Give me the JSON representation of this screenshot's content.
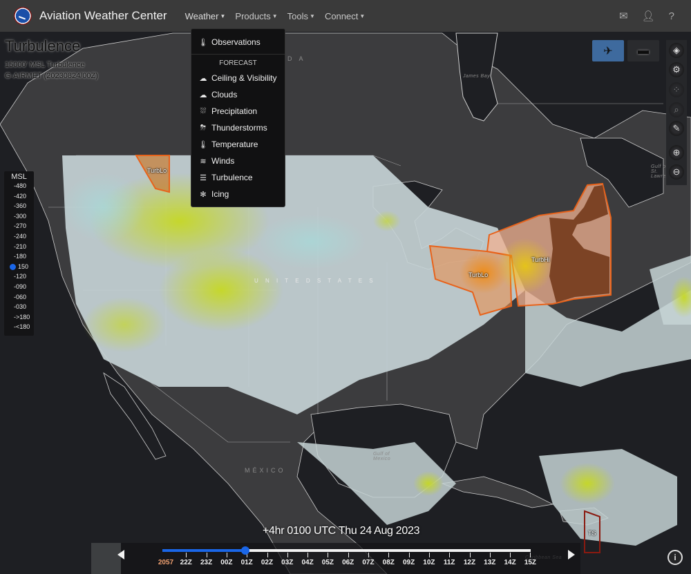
{
  "header": {
    "brand": "Aviation Weather Center",
    "menu": [
      {
        "label": "Weather",
        "active": true
      },
      {
        "label": "Products"
      },
      {
        "label": "Tools"
      },
      {
        "label": "Connect"
      }
    ],
    "right_icons": [
      "mail-icon",
      "user-icon",
      "help-icon"
    ],
    "help_glyph": "?"
  },
  "weather_dropdown": {
    "observations": {
      "label": "Observations",
      "icon": "thermometer-obs-icon"
    },
    "section": "FORECAST",
    "items": [
      {
        "label": "Ceiling & Visibility",
        "icon": "ceiling-icon"
      },
      {
        "label": "Clouds",
        "icon": "cloud-icon"
      },
      {
        "label": "Precipitation",
        "icon": "precipitation-icon"
      },
      {
        "label": "Thunderstorms",
        "icon": "thunderstorm-icon"
      },
      {
        "label": "Temperature",
        "icon": "thermometer-icon"
      },
      {
        "label": "Winds",
        "icon": "wind-icon"
      },
      {
        "label": "Turbulence",
        "icon": "turbulence-icon"
      },
      {
        "label": "Icing",
        "icon": "snowflake-icon"
      }
    ]
  },
  "product": {
    "title": "Turbulence",
    "subtitle": "15000' MSL Turbulence",
    "source": "G-AIRMET (20230824/00Z)"
  },
  "altitude_legend": {
    "header": "MSL",
    "levels": [
      "-480",
      "-420",
      "-360",
      "-300",
      "-270",
      "-240",
      "-210",
      "-180",
      "150",
      "-120",
      "-090",
      "-060",
      "-030",
      "->180",
      "-<180"
    ],
    "selected": "150"
  },
  "map_labels": {
    "canada": "A D A",
    "united_states": "U N I T E D   S T A T E S",
    "mexico": "MÉXICO",
    "james_bay": "James Bay",
    "gulf_of_mexico": "Gulf of Mexico",
    "gulf_st_lawrence": "Gulf of St. Lawrence",
    "caribbean": "Caribbean Sea"
  },
  "advisories": [
    {
      "label": "TurbLo",
      "region": "northern-rockies"
    },
    {
      "label": "TurbLo",
      "region": "great-lakes"
    },
    {
      "label": "TurbHi",
      "region": "northeast"
    },
    {
      "label": "TS",
      "region": "caribbean"
    }
  ],
  "colors": {
    "accent": "#1a66e8",
    "advisory_outline": "#e8621a",
    "ts_outline": "#8a1a10",
    "navbar": "#3a3a3a",
    "timeline_start": "#f0a070"
  },
  "timeline": {
    "title": "+4hr 0100 UTC Thu 24 Aug 2023",
    "labels": [
      "2057",
      "22Z",
      "23Z",
      "00Z",
      "01Z",
      "02Z",
      "03Z",
      "04Z",
      "05Z",
      "06Z",
      "07Z",
      "08Z",
      "09Z",
      "10Z",
      "11Z",
      "12Z",
      "13Z",
      "14Z",
      "15Z"
    ],
    "current": "01Z",
    "progress_fraction": 0.225
  },
  "map_modes": [
    {
      "name": "aviation-mode",
      "active": true
    },
    {
      "name": "marine-mode",
      "active": false
    }
  ]
}
